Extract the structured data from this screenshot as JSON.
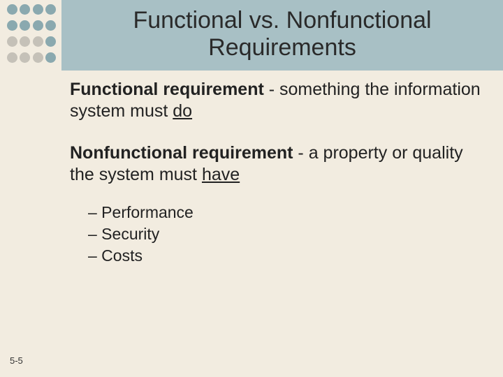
{
  "slide": {
    "title_line": "Functional vs. Nonfunctional Requirements",
    "number": "5-5"
  },
  "content": {
    "func": {
      "label": "Functional requirement",
      "sep": " - ",
      "def_pre": "something the information system must ",
      "def_u": "do"
    },
    "nonfunc": {
      "label": "Nonfunctional requirement",
      "sep": " - ",
      "def_pre": "a property or quality the system must ",
      "def_u": "have"
    },
    "sublist": {
      "items": [
        "– Performance",
        "– Security",
        "– Costs"
      ]
    }
  }
}
